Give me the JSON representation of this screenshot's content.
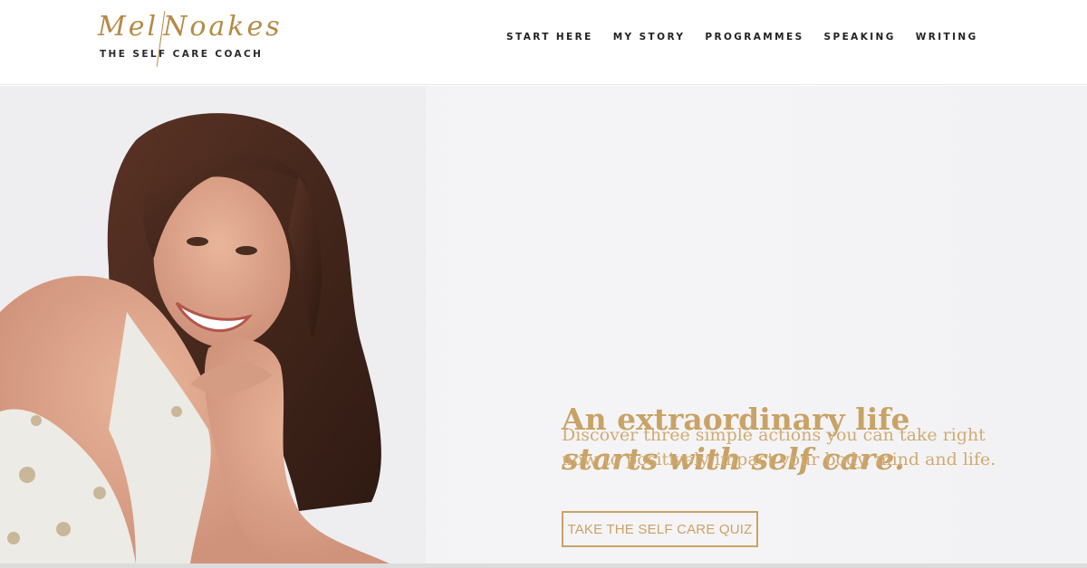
{
  "brand": {
    "script_first": "Mel",
    "script_second": "Noakes",
    "tagline": "THE SELF CARE COACH"
  },
  "nav": {
    "items": [
      {
        "label": "START HERE"
      },
      {
        "label": "MY STORY"
      },
      {
        "label": "PROGRAMMES"
      },
      {
        "label": "SPEAKING"
      },
      {
        "label": "WRITING"
      }
    ]
  },
  "hero": {
    "headline_line1": "An extraordinary life",
    "headline_line2": "starts with self care.",
    "subtext": "Discover three simple actions you can take right now to positively impact your body, mind and life.",
    "cta_label": "TAKE THE SELF CARE QUIZ"
  },
  "colors": {
    "accent_gold": "#c9a266",
    "nav_text": "#222222",
    "hero_bg": "#f3f3f5"
  }
}
